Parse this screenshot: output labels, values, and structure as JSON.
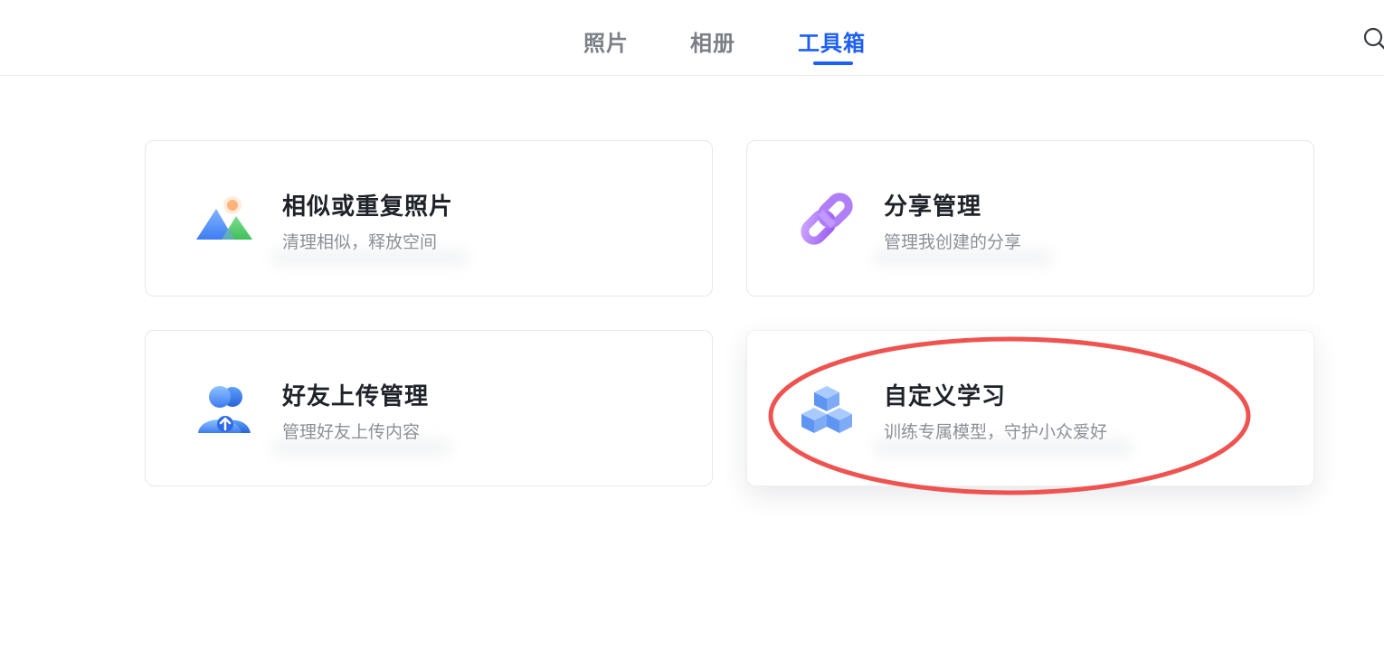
{
  "nav": {
    "tabs": [
      {
        "label": "照片",
        "active": false
      },
      {
        "label": "相册",
        "active": false
      },
      {
        "label": "工具箱",
        "active": true
      }
    ],
    "search_icon": "search-icon",
    "accent_color": "#1d5ff5"
  },
  "cards": [
    {
      "title": "相似或重复照片",
      "desc": "清理相似，释放空间",
      "icon": "similar-photos-icon"
    },
    {
      "title": "分享管理",
      "desc": "管理我创建的分享",
      "icon": "link-icon"
    },
    {
      "title": "好友上传管理",
      "desc": "管理好友上传内容",
      "icon": "friend-upload-icon"
    },
    {
      "title": "自定义学习",
      "desc": "训练专属模型，守护小众爱好",
      "icon": "cubes-icon"
    }
  ],
  "annotation": {
    "type": "ellipse",
    "color": "#ef5350",
    "target": "自定义学习"
  }
}
